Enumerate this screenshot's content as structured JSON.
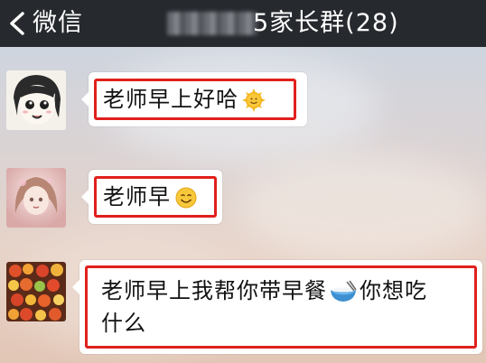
{
  "header": {
    "back_label": "微信",
    "group_name_suffix": "5家长群(28)",
    "back_icon": "chevron-left-icon"
  },
  "messages": [
    {
      "text": "老师早上好哈",
      "emoji": "sun-smile-emoji",
      "avatar": "anime-girl-avatar"
    },
    {
      "text": "老师早",
      "emoji": "smile-emoji",
      "avatar": "pink-girl-avatar"
    },
    {
      "line1": "老师早上我帮你带早餐",
      "emoji": "noodle-bowl-emoji",
      "line1_end": "你想吃",
      "line2": "什么",
      "avatar": "food-avatar"
    }
  ],
  "colors": {
    "titlebar": "#26292e",
    "highlight": "#e0201c",
    "bubble": "#ffffff"
  }
}
